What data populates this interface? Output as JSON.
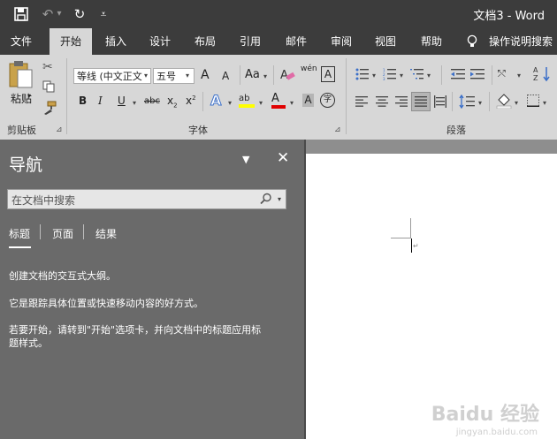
{
  "titlebar": {
    "title": "文档3  -  Word",
    "save_icon": "💾",
    "undo_icon": "↶",
    "undo_dropdown": "▾",
    "redo_icon": "↻",
    "customize_icon": "⩡"
  },
  "tabs": [
    {
      "label": "文件",
      "active": false
    },
    {
      "label": "开始",
      "active": true
    },
    {
      "label": "插入",
      "active": false
    },
    {
      "label": "设计",
      "active": false
    },
    {
      "label": "布局",
      "active": false
    },
    {
      "label": "引用",
      "active": false
    },
    {
      "label": "邮件",
      "active": false
    },
    {
      "label": "审阅",
      "active": false
    },
    {
      "label": "视图",
      "active": false
    },
    {
      "label": "帮助",
      "active": false
    }
  ],
  "tellme": {
    "icon": "lightbulb-icon",
    "label": "操作说明搜索"
  },
  "ribbon": {
    "clipboard": {
      "paste_label": "粘贴",
      "group_label": "剪贴板"
    },
    "font": {
      "font_name": "等线 (中文正文",
      "font_size": "五号",
      "grow": "A",
      "shrink": "A",
      "change_case": "Aa",
      "phonetic": "wén",
      "char_border": "A",
      "bold": "B",
      "italic": "I",
      "underline": "U",
      "strike": "abc",
      "subscript": "x",
      "superscript": "x",
      "text_effect": "A",
      "highlight": "ab",
      "font_color": "A",
      "char_shading": "A",
      "enclose": "字",
      "group_label": "字体"
    },
    "paragraph": {
      "group_label": "段落"
    }
  },
  "nav": {
    "title": "导航",
    "search_placeholder": "在文档中搜索",
    "tabs": [
      "标题",
      "页面",
      "结果"
    ],
    "lines": [
      "创建文档的交互式大纲。",
      "它是跟踪具体位置或快速移动内容的好方式。",
      "若要开始，请转到\"开始\"选项卡，并向文档中的标题应用标",
      "题样式。"
    ]
  },
  "watermark": {
    "brand": "Baidu 经验",
    "url": "jingyan.baidu.com"
  },
  "colors": {
    "titlebar": "#3c3c3c",
    "ribbon": "#d7d7d7",
    "nav": "#6a6a6a",
    "highlight": "#ffff00",
    "font_color": "#e00000"
  }
}
